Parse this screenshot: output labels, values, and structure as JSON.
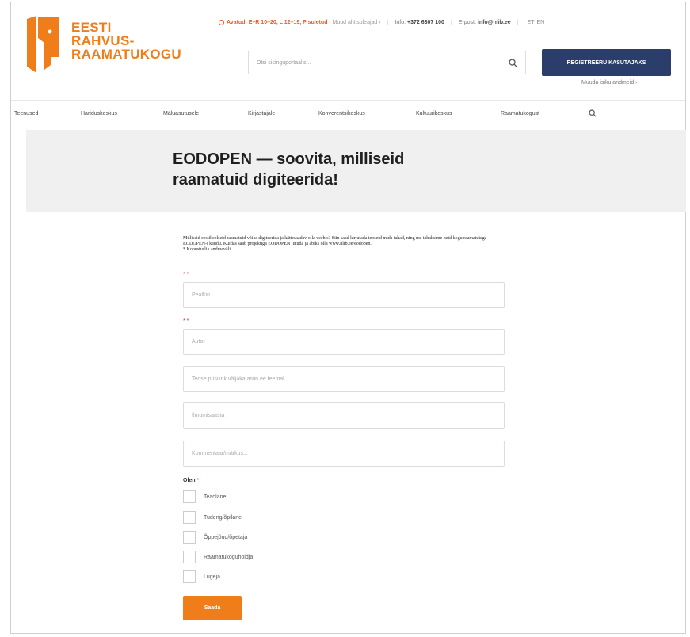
{
  "brand": {
    "lines": [
      "EESTI",
      "RAHVUS-",
      "RAAMATUKOGU"
    ],
    "color": "#ef7d1a"
  },
  "topbar": {
    "open_hours": "Avatud: E–R 10–20, L 12–19, P suletud",
    "more_hours": "Muud ahtisuleajad ›",
    "info_label": "Info:",
    "info_phone": "+372 6307 100",
    "email_label": "E-post:",
    "email": "info@nlib.ee",
    "lang_et": "ET",
    "lang_en": "EN"
  },
  "search": {
    "placeholder": "Otsi sisinguportaalis..."
  },
  "register_button": "REGISTREERU KASUTAJAKS",
  "change_data_link": "Muuda isiku andmeid ›",
  "nav": [
    "Teenused ~",
    "Hariduskeskus ~",
    "Mäluasutusele ~",
    "Kirjastajale ~",
    "Konverentsikeskus ~",
    "Kultuurikeskus ~",
    "Raamatukogust ~"
  ],
  "page_title": "EODOPEN — soovita, milliseid raamatuid digiteerida!",
  "intro_text": "Milliseid eestikeelseid raamatuid võiks digiteerida ja kättesaadav olla veebis? Siin saad kirjutada teoseid mida tahad, ning me tahaksime neid kogu raamatutega EODOPEN-i kaudu. Kuidas saab projektiga EODOPEN liituda ja abiks olla www.nlib.ee/eodopen.",
  "required_note": "* Kohustuslik andmeväli",
  "required_mark": "* *",
  "fields": [
    {
      "placeholder": "Pealkiri"
    },
    {
      "placeholder": "Autor"
    },
    {
      "placeholder": "Teose püsilink väljaka asiin ee teemal ..."
    },
    {
      "placeholder": "Ilmumisaasta"
    },
    {
      "placeholder": "Kommentaar/märkus..."
    }
  ],
  "role": {
    "label": "Olen",
    "required": "*",
    "options": [
      "Teadlane",
      "Tudeng/õpilane",
      "Õppejõud/õpetaja",
      "Raamatukoguhoidja",
      "Lugeja"
    ]
  },
  "submit_label": "Saada",
  "colors": {
    "accent": "#ef7d1a",
    "navy": "#2b3d6b",
    "banner_bg": "#f0f0f0",
    "required_red": "#d0342c"
  }
}
